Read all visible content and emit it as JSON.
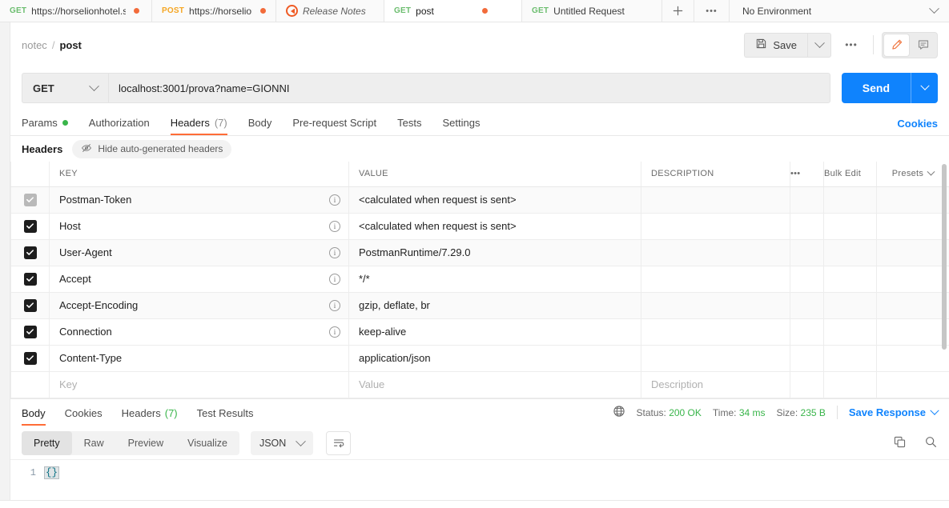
{
  "tabbar": {
    "tabs": [
      {
        "method": "GET",
        "label": "https://horselionhotel.s",
        "unsaved": true,
        "active": false
      },
      {
        "method": "POST",
        "label": "https://horselionhotel",
        "unsaved": true,
        "active": false
      },
      {
        "method": "",
        "label": "Release Notes",
        "unsaved": false,
        "active": false
      },
      {
        "method": "GET",
        "label": "post",
        "unsaved": true,
        "active": true
      },
      {
        "method": "GET",
        "label": "Untitled Request",
        "unsaved": false,
        "active": false
      }
    ],
    "new_tab_label": "+",
    "more_label": "•••",
    "environment": "No Environment"
  },
  "header": {
    "breadcrumb_collection": "notec",
    "breadcrumb_separator": "/",
    "breadcrumb_request": "post",
    "save_label": "Save",
    "more_label": "•••"
  },
  "request": {
    "method": "GET",
    "url": "localhost:3001/prova?name=GIONNI",
    "send_label": "Send",
    "tabs": [
      {
        "label": "Params",
        "badge_dot": true,
        "count": "",
        "active": false
      },
      {
        "label": "Authorization",
        "badge_dot": false,
        "count": "",
        "active": false
      },
      {
        "label": "Headers",
        "badge_dot": false,
        "count": "(7)",
        "active": true
      },
      {
        "label": "Body",
        "badge_dot": false,
        "count": "",
        "active": false
      },
      {
        "label": "Pre-request Script",
        "badge_dot": false,
        "count": "",
        "active": false
      },
      {
        "label": "Tests",
        "badge_dot": false,
        "count": "",
        "active": false
      },
      {
        "label": "Settings",
        "badge_dot": false,
        "count": "",
        "active": false
      }
    ],
    "cookies_link": "Cookies"
  },
  "headers_panel": {
    "title": "Headers",
    "hide_autogen_label": "Hide auto-generated headers",
    "columns": {
      "key": "KEY",
      "value": "VALUE",
      "description": "DESCRIPTION",
      "more": "•••",
      "bulk_edit": "Bulk Edit",
      "presets": "Presets"
    },
    "rows": [
      {
        "checked": true,
        "disabled": true,
        "info": true,
        "key": "Postman-Token",
        "value": "<calculated when request is sent>",
        "description": ""
      },
      {
        "checked": true,
        "disabled": false,
        "info": true,
        "key": "Host",
        "value": "<calculated when request is sent>",
        "description": ""
      },
      {
        "checked": true,
        "disabled": false,
        "info": true,
        "key": "User-Agent",
        "value": "PostmanRuntime/7.29.0",
        "description": ""
      },
      {
        "checked": true,
        "disabled": false,
        "info": true,
        "key": "Accept",
        "value": "*/*",
        "description": ""
      },
      {
        "checked": true,
        "disabled": false,
        "info": true,
        "key": "Accept-Encoding",
        "value": "gzip, deflate, br",
        "description": ""
      },
      {
        "checked": true,
        "disabled": false,
        "info": true,
        "key": "Connection",
        "value": "keep-alive",
        "description": ""
      },
      {
        "checked": true,
        "disabled": false,
        "info": false,
        "key": "Content-Type",
        "value": "application/json",
        "description": ""
      }
    ],
    "new_row": {
      "key_placeholder": "Key",
      "value_placeholder": "Value",
      "description_placeholder": "Description"
    }
  },
  "response": {
    "tabs": [
      {
        "label": "Body",
        "count": "",
        "active": true
      },
      {
        "label": "Cookies",
        "count": "",
        "active": false
      },
      {
        "label": "Headers",
        "count": "(7)",
        "active": false
      },
      {
        "label": "Test Results",
        "count": "",
        "active": false
      }
    ],
    "status_label": "Status:",
    "status_value": "200 OK",
    "time_label": "Time:",
    "time_value": "34 ms",
    "size_label": "Size:",
    "size_value": "235 B",
    "save_response_label": "Save Response",
    "view_modes": [
      {
        "label": "Pretty",
        "active": true
      },
      {
        "label": "Raw",
        "active": false
      },
      {
        "label": "Preview",
        "active": false
      },
      {
        "label": "Visualize",
        "active": false
      }
    ],
    "format": "JSON",
    "line_numbers": [
      "1"
    ],
    "body_text": "{}"
  },
  "colors": {
    "accent_orange": "#ff6c37",
    "get_green": "#6bbd6e",
    "post_orange": "#f5a623",
    "send_blue": "#0f83fd",
    "status_green": "#39b54a",
    "link_blue": "#0f83fd"
  }
}
